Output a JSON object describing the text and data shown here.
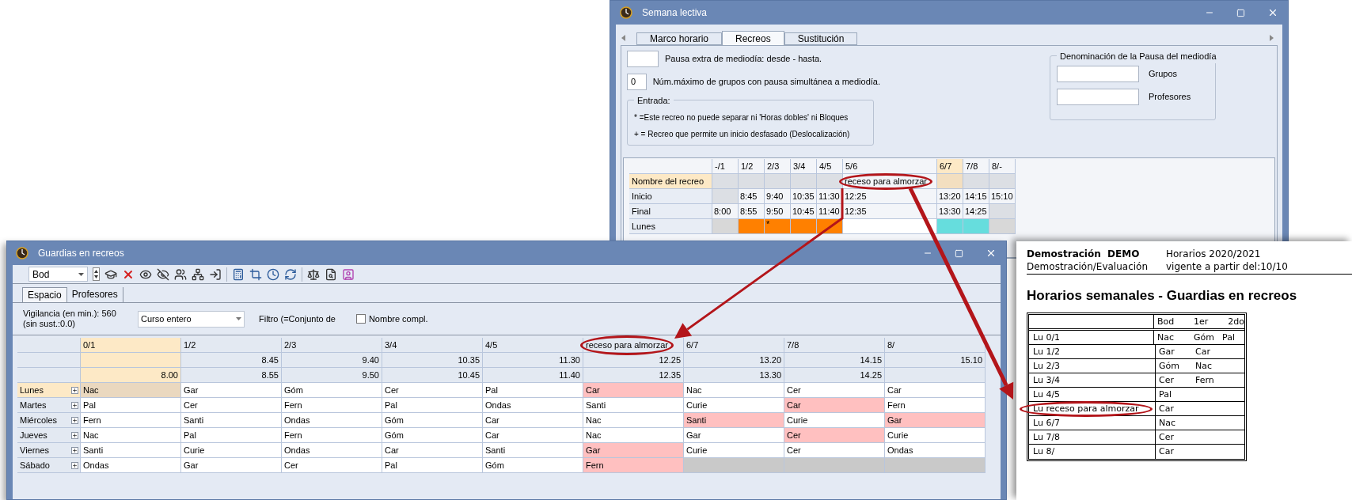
{
  "top_window": {
    "title": "Semana lectiva",
    "tabs": [
      {
        "label": "Marco horario",
        "selected": false
      },
      {
        "label": "Recreos",
        "selected": true
      },
      {
        "label": "Sustitución",
        "selected": false
      }
    ],
    "fields": [
      {
        "label": "Pausa extra de mediodía: desde - hasta."
      },
      {
        "value": "0",
        "label": "Núm.máximo de grupos con pausa simultánea a mediodía."
      }
    ],
    "legend": {
      "title": "Entrada:",
      "lines": [
        "* =Este recreo no puede separar ni 'Horas dobles' ni Bloques",
        "+ = Recreo que permite un inicio desfasado (Deslocalización)"
      ]
    },
    "naming_group": {
      "title": "Denominación de la Pausa del mediodía",
      "fields": [
        {
          "label": "Grupos"
        },
        {
          "label": "Profesores"
        }
      ]
    },
    "grid": {
      "columns": [
        {
          "label": "-/1",
          "selected": false
        },
        {
          "label": "1/2",
          "selected": false
        },
        {
          "label": "2/3",
          "selected": false
        },
        {
          "label": "3/4",
          "selected": false
        },
        {
          "label": "4/5",
          "selected": false
        },
        {
          "label": "5/6",
          "selected": false
        },
        {
          "label": "6/7",
          "selected": true
        },
        {
          "label": "7/8",
          "selected": false
        },
        {
          "label": "8/-",
          "selected": false
        }
      ],
      "rows": [
        {
          "label": "Nombre del recreo",
          "selected": true,
          "cells": [
            null,
            null,
            null,
            null,
            null,
            "receso para almorzar",
            null,
            null,
            null
          ]
        },
        {
          "label": "Inicio",
          "selected": false,
          "cells": [
            null,
            "8:45",
            "9:40",
            "10:35",
            "11:30",
            "12:25",
            "13:20",
            "14:15",
            "15:10"
          ]
        },
        {
          "label": "Final",
          "selected": false,
          "cells": [
            "8:00",
            "8:55",
            "9:50",
            "10:45",
            "11:40",
            "12:35",
            "13:30",
            "14:25",
            null
          ]
        }
      ],
      "day_row": {
        "label": "Lunes",
        "cells": [
          {
            "color": "#d8d8d8"
          },
          {
            "color": "#ff8000"
          },
          {
            "color": "#ff8000",
            "text": "*"
          },
          {
            "color": "#ff8000"
          },
          {
            "color": "#ff8000"
          },
          {
            "color": "#ffffff"
          },
          {
            "color": "#66dddd"
          },
          {
            "color": "#66dddd"
          },
          {
            "color": "#d8d8d8"
          }
        ]
      }
    }
  },
  "bottom_window": {
    "title": "Guardias en recreos",
    "selector": {
      "value": "Bod"
    },
    "tabs": [
      {
        "label": "Espacio",
        "selected": true
      },
      {
        "label": "Profesores",
        "selected": false
      }
    ],
    "vigilance": "Vigilancia (en min.): 560 (sin sust.:0.0)",
    "course": {
      "value": "Curso entero"
    },
    "filter_label": "Filtro (=Conjunto de",
    "full_name": {
      "label": "Nombre compl.",
      "checked": false
    },
    "grid": {
      "columns": [
        {
          "label": "0/1",
          "selected": true,
          "end": "8.00"
        },
        {
          "label": "1/2",
          "selected": false,
          "start": "8.45",
          "end": "8.55"
        },
        {
          "label": "2/3",
          "selected": false,
          "start": "9.40",
          "end": "9.50"
        },
        {
          "label": "3/4",
          "selected": false,
          "start": "10.35",
          "end": "10.45"
        },
        {
          "label": "4/5",
          "selected": false,
          "start": "11.30",
          "end": "11.40"
        },
        {
          "label": "receso para almorzar",
          "selected": false,
          "start": "12.25",
          "end": "12.35"
        },
        {
          "label": "6/7",
          "selected": false,
          "start": "13.20",
          "end": "13.30"
        },
        {
          "label": "7/8",
          "selected": false,
          "start": "14.15",
          "end": "14.25"
        },
        {
          "label": "8/",
          "selected": false,
          "start": "15.10"
        }
      ],
      "rows": [
        {
          "day": "Lunes",
          "selected": true,
          "cells": [
            {
              "text": "Nac",
              "selected": true,
              "highlighted": false
            },
            {
              "text": "Gar",
              "selected": false,
              "highlighted": false
            },
            {
              "text": "Góm",
              "selected": false,
              "highlighted": false
            },
            {
              "text": "Cer",
              "selected": false,
              "highlighted": false
            },
            {
              "text": "Pal",
              "selected": false,
              "highlighted": false
            },
            {
              "text": "Car",
              "selected": false,
              "highlighted": true
            },
            {
              "text": "Nac",
              "selected": false,
              "highlighted": false
            },
            {
              "text": "Cer",
              "selected": false,
              "highlighted": false
            },
            {
              "text": "Car",
              "selected": false,
              "highlighted": false
            }
          ]
        },
        {
          "day": "Martes",
          "selected": false,
          "cells": [
            {
              "text": "Pal",
              "selected": false,
              "highlighted": false
            },
            {
              "text": "Cer",
              "selected": false,
              "highlighted": false
            },
            {
              "text": "Fern",
              "selected": false,
              "highlighted": false
            },
            {
              "text": "Pal",
              "selected": false,
              "highlighted": false
            },
            {
              "text": "Ondas",
              "selected": false,
              "highlighted": false
            },
            {
              "text": "Santi",
              "selected": false,
              "highlighted": false
            },
            {
              "text": "Curie",
              "selected": false,
              "highlighted": false
            },
            {
              "text": "Car",
              "selected": false,
              "highlighted": true
            },
            {
              "text": "Fern",
              "selected": false,
              "highlighted": false
            }
          ]
        },
        {
          "day": "Miércoles",
          "selected": false,
          "cells": [
            {
              "text": "Fern",
              "selected": false,
              "highlighted": false
            },
            {
              "text": "Santi",
              "selected": false,
              "highlighted": false
            },
            {
              "text": "Ondas",
              "selected": false,
              "highlighted": false
            },
            {
              "text": "Góm",
              "selected": false,
              "highlighted": false
            },
            {
              "text": "Car",
              "selected": false,
              "highlighted": false
            },
            {
              "text": "Nac",
              "selected": false,
              "highlighted": false
            },
            {
              "text": "Santi",
              "selected": false,
              "highlighted": true
            },
            {
              "text": "Curie",
              "selected": false,
              "highlighted": false
            },
            {
              "text": "Gar",
              "selected": false,
              "highlighted": true
            }
          ]
        },
        {
          "day": "Jueves",
          "selected": false,
          "cells": [
            {
              "text": "Nac",
              "selected": false,
              "highlighted": false
            },
            {
              "text": "Pal",
              "selected": false,
              "highlighted": false
            },
            {
              "text": "Fern",
              "selected": false,
              "highlighted": false
            },
            {
              "text": "Góm",
              "selected": false,
              "highlighted": false
            },
            {
              "text": "Car",
              "selected": false,
              "highlighted": false
            },
            {
              "text": "Nac",
              "selected": false,
              "highlighted": false
            },
            {
              "text": "Gar",
              "selected": false,
              "highlighted": false
            },
            {
              "text": "Cer",
              "selected": false,
              "highlighted": true
            },
            {
              "text": "Curie",
              "selected": false,
              "highlighted": false
            }
          ]
        },
        {
          "day": "Viernes",
          "selected": false,
          "cells": [
            {
              "text": "Santi",
              "selected": false,
              "highlighted": false
            },
            {
              "text": "Curie",
              "selected": false,
              "highlighted": false
            },
            {
              "text": "Ondas",
              "selected": false,
              "highlighted": false
            },
            {
              "text": "Car",
              "selected": false,
              "highlighted": false
            },
            {
              "text": "Santi",
              "selected": false,
              "highlighted": false
            },
            {
              "text": "Gar",
              "selected": false,
              "highlighted": true
            },
            {
              "text": "Curie",
              "selected": false,
              "highlighted": false
            },
            {
              "text": "Cer",
              "selected": false,
              "highlighted": false
            },
            {
              "text": "Ondas",
              "selected": false,
              "highlighted": false
            }
          ]
        },
        {
          "day": "Sábado",
          "selected": false,
          "cells": [
            {
              "text": "Ondas",
              "selected": false,
              "highlighted": false
            },
            {
              "text": "Gar",
              "selected": false,
              "highlighted": false
            },
            {
              "text": "Cer",
              "selected": false,
              "highlighted": false
            },
            {
              "text": "Pal",
              "selected": false,
              "highlighted": false
            },
            {
              "text": "Góm",
              "selected": false,
              "highlighted": false
            },
            {
              "text": "Fern",
              "selected": false,
              "highlighted": true
            },
            {
              "selected": false,
              "highlighted": false
            },
            {
              "selected": false,
              "highlighted": false
            },
            {
              "selected": false,
              "highlighted": false
            }
          ]
        }
      ]
    }
  },
  "printout": {
    "school": "Demostración  DEMO",
    "subtitle": "Demostración/Evaluación",
    "schedule": "Horarios 2020/2021",
    "valid_from": "vigente a partir del:10/10",
    "title": "Horarios semanales - Guardias en recreos",
    "columns": [
      "Bod",
      "1er",
      "2do"
    ],
    "rows": [
      {
        "label": "Lu 0/1",
        "values": [
          "Nac",
          "Góm",
          "Pal"
        ]
      },
      {
        "label": "Lu 1/2",
        "values": [
          "Gar",
          "Car"
        ]
      },
      {
        "label": "Lu 2/3",
        "values": [
          "Góm",
          "Nac"
        ]
      },
      {
        "label": "Lu 3/4",
        "values": [
          "Cer",
          "Fern"
        ]
      },
      {
        "label": "Lu 4/5",
        "values": [
          "Pal"
        ]
      },
      {
        "label": "Lu receso para almorzar",
        "values": [
          "Car"
        ]
      },
      {
        "label": "Lu 6/7",
        "values": [
          "Nac"
        ]
      },
      {
        "label": "Lu 7/8",
        "values": [
          "Cer"
        ]
      },
      {
        "label": "Lu 8/",
        "values": [
          "Car"
        ]
      }
    ]
  }
}
